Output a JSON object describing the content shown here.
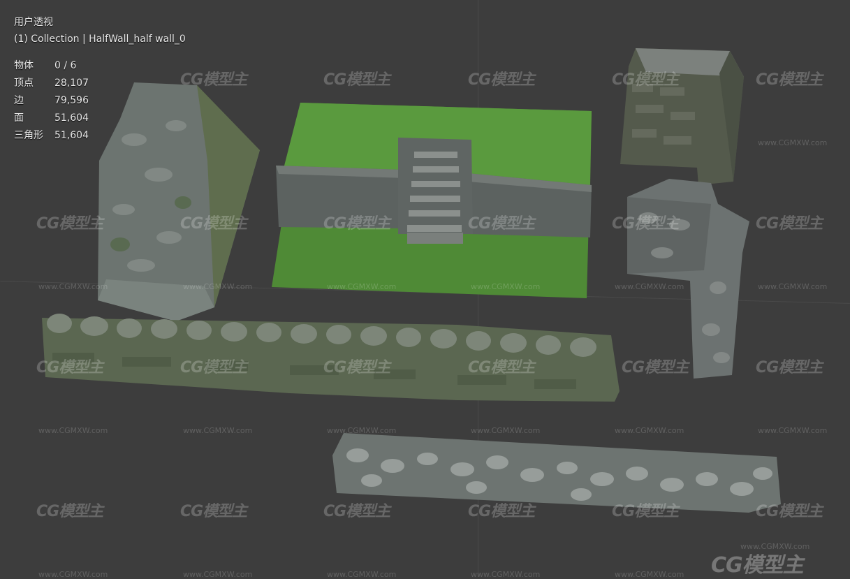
{
  "viewport": {
    "view_name": "用户透视",
    "collection_line": "(1) Collection | HalfWall_half wall_0"
  },
  "stats": [
    {
      "label": "物体",
      "value": "0 / 6"
    },
    {
      "label": "顶点",
      "value": "28,107"
    },
    {
      "label": "边",
      "value": "79,596"
    },
    {
      "label": "面",
      "value": "51,604"
    },
    {
      "label": "三角形",
      "value": "51,604"
    }
  ],
  "watermark": {
    "logo": "CG模型主",
    "url": "www.CGMXW.com"
  },
  "colors": {
    "background": "#3d3d3d",
    "grass": "#4f8a36",
    "stone": "#6f7571",
    "moss": "#5b6f48"
  }
}
